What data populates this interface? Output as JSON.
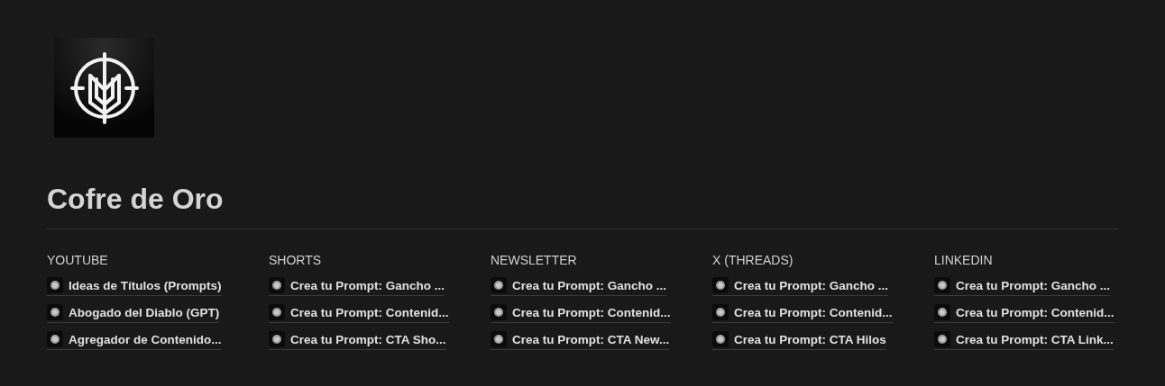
{
  "page": {
    "title": "Cofre de Oro"
  },
  "columns": [
    {
      "heading": "YOUTUBE",
      "links": [
        "Ideas de Títulos (Prompts)",
        "Abogado del Diablo (GPT)",
        "Agregador de Contenido..."
      ]
    },
    {
      "heading": "SHORTS",
      "links": [
        "Crea tu Prompt: Gancho ...",
        "Crea tu Prompt: Contenid...",
        "Crea tu Prompt: CTA Sho..."
      ]
    },
    {
      "heading": "NEWSLETTER",
      "links": [
        "Crea tu Prompt: Gancho ...",
        "Crea tu Prompt: Contenid...",
        "Crea tu Prompt: CTA New..."
      ]
    },
    {
      "heading": "X (THREADS)",
      "links": [
        "Crea tu Prompt: Gancho ...",
        "Crea tu Prompt: Contenid...",
        "Crea tu Prompt: CTA Hilos"
      ]
    },
    {
      "heading": "LINKEDIN",
      "links": [
        "Crea tu Prompt: Gancho ...",
        "Crea tu Prompt: Contenid...",
        "Crea tu Prompt: CTA Link..."
      ]
    }
  ]
}
